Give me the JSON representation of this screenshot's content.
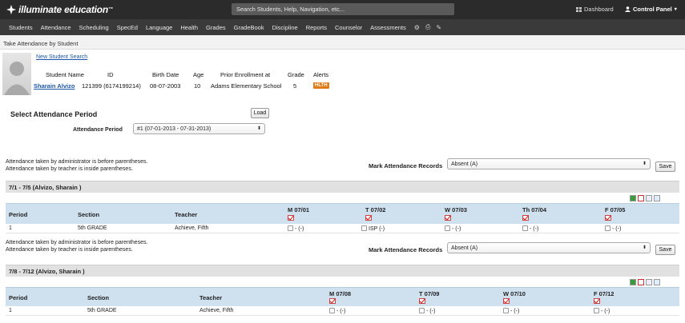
{
  "topbar": {
    "logo_text": "illuminate education",
    "logo_tm": "™",
    "search_placeholder": "Search Students, Help, Navigation, etc...",
    "dashboard_label": "Dashboard",
    "control_panel_label": "Control Panel",
    "control_panel_caret": "▾"
  },
  "nav": {
    "items": [
      "Students",
      "Attendance",
      "Scheduling",
      "SpecEd",
      "Language",
      "Health",
      "Grades",
      "GradeBook",
      "Discipline",
      "Reports",
      "Counselor",
      "Assessments"
    ]
  },
  "page": {
    "title": "Take Attendance by Student"
  },
  "student": {
    "new_search_link": "New Student Search",
    "headers": {
      "name": "Student Name",
      "id": "ID",
      "birth": "Birth Date",
      "age": "Age",
      "prior": "Prior Enrollment at",
      "grade": "Grade",
      "alerts": "Alerts"
    },
    "name": "Sharain Alvizo",
    "id": "121399 (6174199214)",
    "birth": "08-07-2003",
    "age": "10",
    "prior": "Adams Elementary School",
    "grade": "5",
    "alert_badge": "HLTH"
  },
  "period_select": {
    "heading": "Select Attendance Period",
    "load_label": "Load",
    "field_label": "Attendance Period",
    "value": "#1 (07-01-2013 - 07-31-2013)"
  },
  "notes": {
    "line1": "Attendance taken by administrator is before parentheses.",
    "line2": "Attendance taken by teacher is inside parentheses."
  },
  "mark": {
    "label": "Mark Attendance Records",
    "value": "Absent (A)",
    "save_label": "Save"
  },
  "weeks": [
    {
      "title": "7/1 - 7/5 (Alvizo, Sharain )",
      "columns": {
        "period": "Period",
        "section": "Section",
        "teacher": "Teacher"
      },
      "days": [
        "M 07/01",
        "T 07/02",
        "W 07/03",
        "Th 07/04",
        "F 07/05"
      ],
      "rows": [
        {
          "period": "1",
          "section": "5th GRADE",
          "teacher": "Achieve, Fifth",
          "cells": [
            "- (-)",
            "ISP (-)",
            "- (-)",
            "- (-)",
            "- (-)"
          ]
        }
      ]
    },
    {
      "title": "7/8 - 7/12 (Alvizo, Sharain )",
      "columns": {
        "period": "Period",
        "section": "Section",
        "teacher": "Teacher"
      },
      "days": [
        "M 07/08",
        "T 07/09",
        "W 07/10",
        "F 07/12"
      ],
      "rows": [
        {
          "period": "1",
          "section": "5th GRADE",
          "teacher": "Achieve, Fifth",
          "cells": [
            "- (-)",
            "- (-)",
            "- (-)",
            "- (-)"
          ]
        }
      ]
    }
  ]
}
